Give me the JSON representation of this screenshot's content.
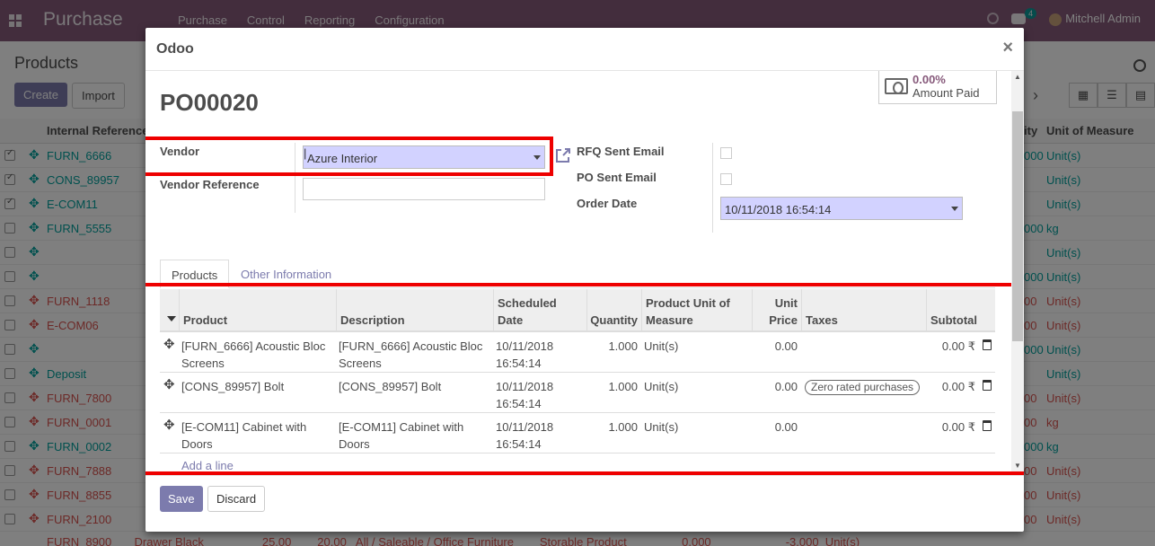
{
  "navbar": {
    "brand": "Purchase",
    "menu": [
      "Purchase",
      "Control",
      "Reporting",
      "Configuration"
    ],
    "chat_count": "4",
    "user": "Mitchell Admin"
  },
  "list": {
    "title": "Products",
    "create_label": "Create",
    "import_label": "Import",
    "col_ref": "Internal Reference",
    "col_qty_partial": "ity",
    "col_uom": "Unit of Measure",
    "rows": [
      {
        "ref": "FURN_6666",
        "qty": "000",
        "uom": "Unit(s)"
      },
      {
        "ref": "CONS_89957",
        "qty": "",
        "uom": "Unit(s)"
      },
      {
        "ref": "E-COM11",
        "qty": "",
        "uom": "Unit(s)"
      },
      {
        "ref": "FURN_5555",
        "qty": "000",
        "uom": "kg"
      },
      {
        "ref": "",
        "qty": "",
        "uom": "Unit(s)"
      },
      {
        "ref": "",
        "qty": "000",
        "uom": "Unit(s)"
      },
      {
        "ref": "FURN_1118",
        "qty": "00",
        "uom": "Unit(s)"
      },
      {
        "ref": "E-COM06",
        "qty": "00",
        "uom": "Unit(s)"
      },
      {
        "ref": "",
        "qty": "000",
        "uom": "Unit(s)"
      },
      {
        "ref": "Deposit",
        "qty": "",
        "uom": "Unit(s)"
      },
      {
        "ref": "FURN_7800",
        "qty": "00",
        "uom": "Unit(s)"
      },
      {
        "ref": "FURN_0001",
        "qty": "00",
        "uom": "kg"
      },
      {
        "ref": "FURN_0002",
        "qty": "000",
        "uom": "kg"
      },
      {
        "ref": "FURN_7888",
        "qty": "00",
        "uom": "Unit(s)"
      },
      {
        "ref": "FURN_8855",
        "qty": "00",
        "uom": "Unit(s)"
      },
      {
        "ref": "FURN_2100",
        "qty": "00",
        "uom": "Unit(s)"
      }
    ],
    "last_row": "FURN_8900       Drawer Black                  25.00        20.00   All / Saleable / Office Furniture        Storable Product                 0.000                       -3.000  Unit(s)"
  },
  "modal": {
    "title": "Odoo",
    "po_name": "PO00020",
    "amount_paid_value": "0.00%",
    "amount_paid_label": "Amount Paid",
    "vendor_label": "Vendor",
    "vendor_value": "Azure Interior",
    "vendor_ref_label": "Vendor Reference",
    "vendor_ref_value": "",
    "rfq_sent_label": "RFQ Sent Email",
    "po_sent_label": "PO Sent Email",
    "order_date_label": "Order Date",
    "order_date_value": "10/11/2018 16:54:14",
    "tab_products": "Products",
    "tab_other": "Other Information",
    "columns": {
      "product": "Product",
      "description": "Description",
      "scheduled": "Scheduled Date",
      "quantity": "Quantity",
      "uom": "Product Unit of Measure",
      "unit_price": "Unit Price",
      "taxes": "Taxes",
      "subtotal": "Subtotal"
    },
    "lines": [
      {
        "product": "[FURN_6666] Acoustic Bloc Screens",
        "description": "[FURN_6666] Acoustic Bloc Screens",
        "date": "10/11/2018 16:54:14",
        "qty": "1.000",
        "uom": "Unit(s)",
        "price": "0.00",
        "tax": "",
        "subtotal": "0.00 ₹"
      },
      {
        "product": "[CONS_89957] Bolt",
        "description": "[CONS_89957] Bolt",
        "date": "10/11/2018 16:54:14",
        "qty": "1.000",
        "uom": "Unit(s)",
        "price": "0.00",
        "tax": "Zero rated purchases",
        "subtotal": "0.00 ₹"
      },
      {
        "product": "[E-COM11] Cabinet with Doors",
        "description": "[E-COM11] Cabinet with Doors",
        "date": "10/11/2018 16:54:14",
        "qty": "1.000",
        "uom": "Unit(s)",
        "price": "0.00",
        "tax": "",
        "subtotal": "0.00 ₹"
      }
    ],
    "add_line": "Add a line",
    "save_label": "Save",
    "discard_label": "Discard"
  }
}
